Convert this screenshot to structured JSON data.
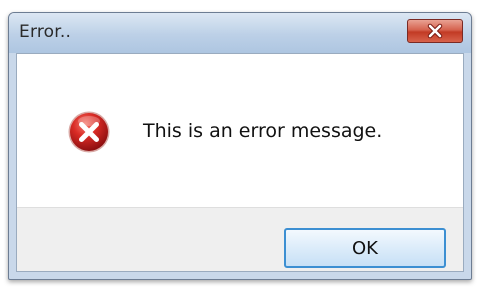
{
  "window": {
    "title": "Error..",
    "close_icon": "close-icon",
    "accent_color": "#c23a25"
  },
  "content": {
    "icon": "error-icon",
    "icon_color": "#c8202a",
    "message": "This is an error message."
  },
  "footer": {
    "ok_label": "OK",
    "ok_border_color": "#3c8fd2"
  }
}
